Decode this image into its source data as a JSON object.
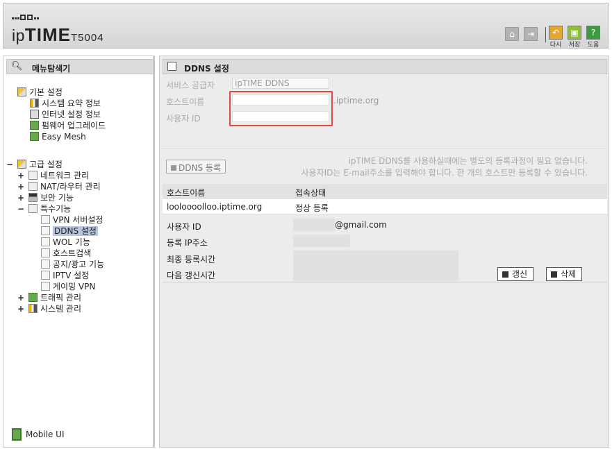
{
  "header": {
    "brand_prefix": "ip",
    "brand_main": "TIME",
    "brand_model": "T5004",
    "buttons": [
      {
        "name": "home",
        "label": ""
      },
      {
        "name": "logout",
        "label": ""
      },
      {
        "name": "redo",
        "label": "다시"
      },
      {
        "name": "save",
        "label": "저장"
      },
      {
        "name": "help",
        "label": "도움"
      }
    ]
  },
  "sidebar": {
    "title": "메뉴탐색기",
    "groups": [
      {
        "label": "기본 설정",
        "items": [
          "시스템 요약 정보",
          "인터넷 설정 정보",
          "펌웨어 업그레이드",
          "Easy Mesh"
        ]
      },
      {
        "label": "고급 설정"
      }
    ],
    "advanced": [
      "네트워크 관리",
      "NAT/라우터 관리",
      "보안 기능",
      "특수기능"
    ],
    "special": [
      "VPN 서버설정",
      "DDNS 설정",
      "WOL 기능",
      "호스트검색",
      "공지/광고 기능",
      "IPTV 설정",
      "게이밍 VPN"
    ],
    "advanced_tail": [
      "트래픽 관리",
      "시스템 관리"
    ],
    "plus": "+",
    "minus": "−",
    "mobile": "Mobile UI"
  },
  "main": {
    "title": "DDNS 설정",
    "provider_label": "서비스 공급자",
    "provider_value": "ipTIME DDNS",
    "host_label": "호스트이름",
    "host_suffix": ".iptime.org",
    "user_label": "사용자 ID",
    "ddns_button": "DDNS 등록",
    "info_line1": "ipTIME DDNS를 사용하실때에는 별도의 등록과정이 필요 없습니다.",
    "info_line2": "사용자ID는 E-mail주소를 입력해야 합니다. 한 개의 호스트만 등록할 수 있습니다.",
    "table": {
      "col_host": "호스트이름",
      "col_status": "접속상태",
      "row_host": "looloooolloo.iptime.org",
      "row_status": "정상 등록"
    },
    "details": {
      "user_id_label": "사용자 ID",
      "user_id_suffix": "@gmail.com",
      "ip_label": "등록 IP주소",
      "last_label": "최종 등록시간",
      "next_label": "다음 갱신시간"
    },
    "refresh_button": "갱신",
    "delete_button": "삭제"
  }
}
